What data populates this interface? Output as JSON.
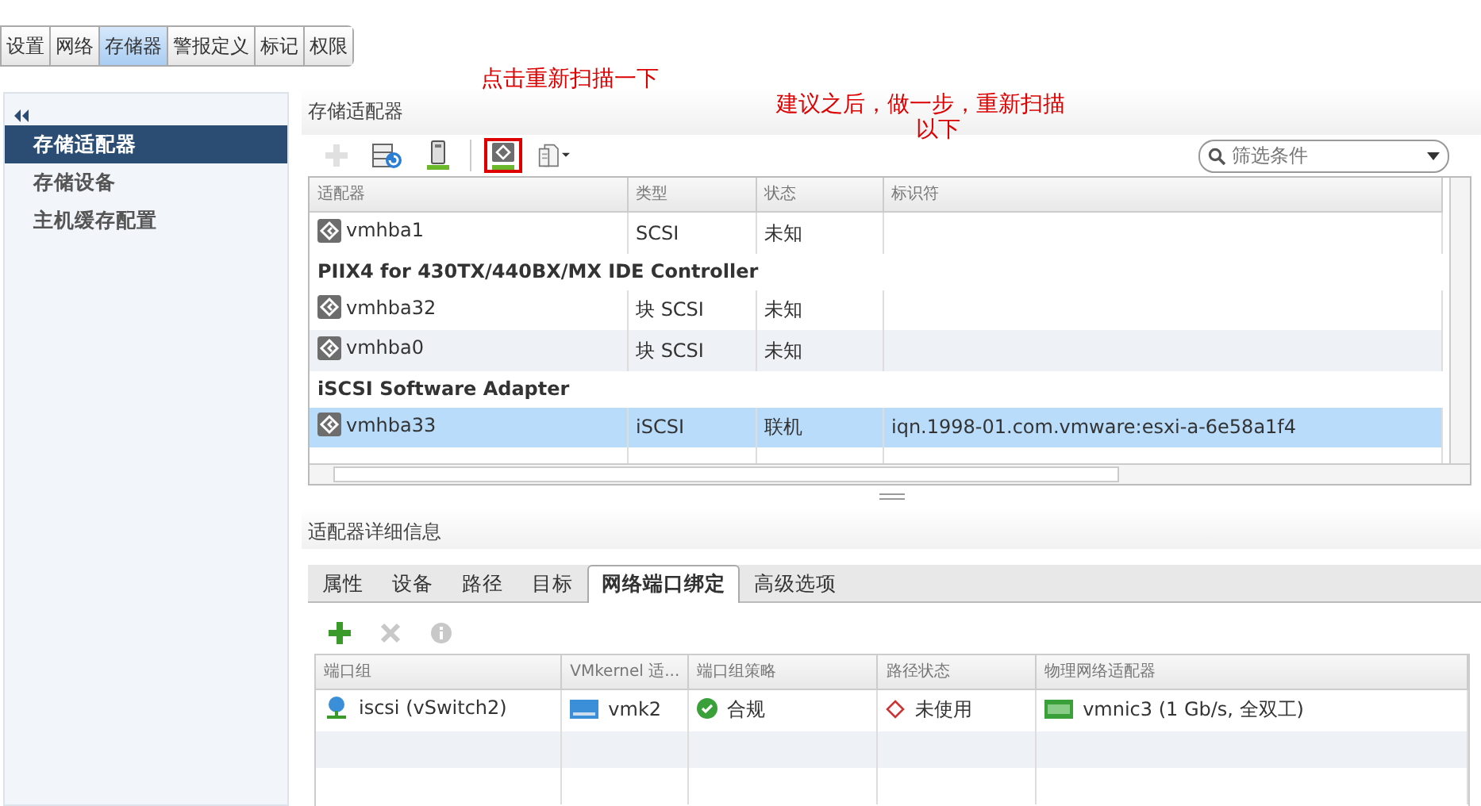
{
  "top_tabs": [
    {
      "label": "设置",
      "selected": false
    },
    {
      "label": "网络",
      "selected": false
    },
    {
      "label": "存储器",
      "selected": true
    },
    {
      "label": "警报定义",
      "selected": false
    },
    {
      "label": "标记",
      "selected": false
    },
    {
      "label": "权限",
      "selected": false
    }
  ],
  "sidebar": {
    "items": [
      {
        "label": "存储适配器",
        "selected": true
      },
      {
        "label": "存储设备",
        "selected": false
      },
      {
        "label": "主机缓存配置",
        "selected": false
      }
    ]
  },
  "adapters": {
    "title": "存储适配器",
    "toolbar": [
      {
        "kind": "add",
        "disabled": true,
        "highlighted": false
      },
      {
        "kind": "refresh",
        "disabled": false,
        "highlighted": false
      },
      {
        "kind": "device",
        "disabled": false,
        "highlighted": false
      },
      {
        "kind": "rescan",
        "disabled": false,
        "highlighted": true
      },
      {
        "kind": "export",
        "disabled": false,
        "highlighted": false
      }
    ],
    "filter": {
      "placeholder": "筛选条件"
    },
    "columns": [
      "适配器",
      "类型",
      "状态",
      "标识符"
    ],
    "rows": [
      {
        "kind": "adapter",
        "name": "vmhba1",
        "type": "SCSI",
        "status": "未知",
        "identifier": "",
        "selected": false
      },
      {
        "kind": "group",
        "name": "PIIX4 for 430TX/440BX/MX IDE Controller"
      },
      {
        "kind": "adapter",
        "name": "vmhba32",
        "type": "块 SCSI",
        "status": "未知",
        "identifier": "",
        "selected": false
      },
      {
        "kind": "adapter",
        "name": "vmhba0",
        "type": "块 SCSI",
        "status": "未知",
        "identifier": "",
        "selected": false
      },
      {
        "kind": "group",
        "name": "iSCSI Software Adapter"
      },
      {
        "kind": "adapter",
        "name": "vmhba33",
        "type": "iSCSI",
        "status": "联机",
        "identifier": "iqn.1998-01.com.vmware:esxi-a-6e58a1f4",
        "selected": true
      }
    ]
  },
  "details": {
    "title": "适配器详细信息",
    "tabs": [
      {
        "label": "属性",
        "selected": false
      },
      {
        "label": "设备",
        "selected": false
      },
      {
        "label": "路径",
        "selected": false
      },
      {
        "label": "目标",
        "selected": false
      },
      {
        "label": "网络端口绑定",
        "selected": true
      },
      {
        "label": "高级选项",
        "selected": false
      }
    ],
    "toolbar": [
      {
        "kind": "add",
        "disabled": false
      },
      {
        "kind": "remove",
        "disabled": true
      },
      {
        "kind": "info",
        "disabled": true
      }
    ],
    "columns": [
      "端口组",
      "VMkernel 适...",
      "端口组策略",
      "路径状态",
      "物理网络适配器"
    ],
    "rows": [
      {
        "port_group": "iscsi (vSwitch2)",
        "vmkernel": "vmk2",
        "policy": "合规",
        "path_status": "未使用",
        "physical_adapter": "vmnic3 (1 Gb/s, 全双工)"
      }
    ]
  },
  "annotations": [
    {
      "text": "点击重新扫描一下"
    },
    {
      "text": "建议之后，做一步，重新扫描"
    },
    {
      "text": "以下"
    }
  ]
}
